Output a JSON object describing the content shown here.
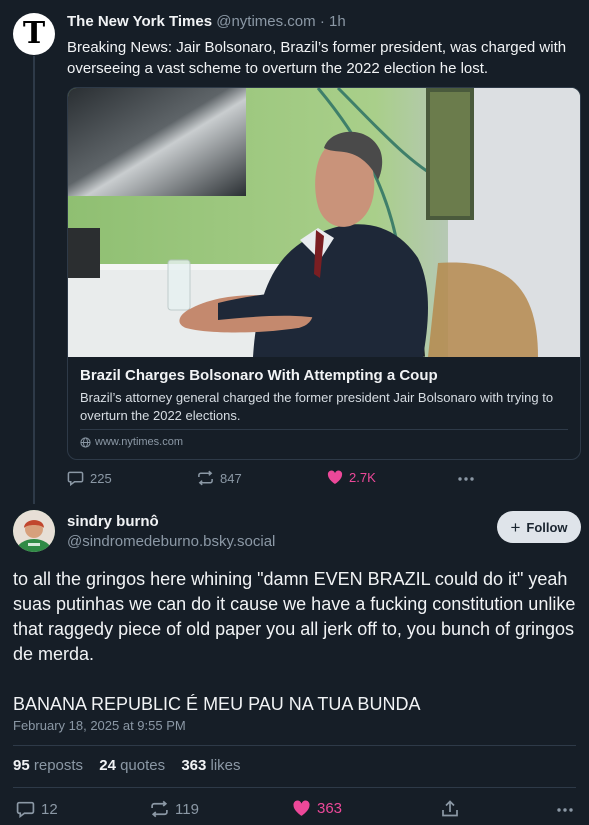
{
  "parent_post": {
    "author_name": "The New York Times",
    "handle": "@nytimes.com",
    "separator": "·",
    "time_ago": "1h",
    "avatar_glyph": "T",
    "text": "Breaking News: Jair Bolsonaro, Brazil’s former president, was charged with overseeing a vast scheme to overturn the 2022 election he lost.",
    "link_card": {
      "title": "Brazil Charges Bolsonaro With Attempting a Coup",
      "description": "Brazil’s attorney general charged the former president Jair Bolsonaro with trying to overturn the 2022 elections.",
      "domain": "www.nytimes.com",
      "domain_icon": "globe-icon"
    },
    "actions": {
      "replies": "225",
      "reposts": "847",
      "likes": "2.7K",
      "more_icon": "ellipsis-icon"
    }
  },
  "main_post": {
    "author_name": "sindry burnô",
    "handle": "@sindromedeburno.bsky.social",
    "follow_label": "Follow",
    "paragraphs": [
      "to all the gringos here whining \"damn EVEN BRAZIL could do it\" yeah suas putinhas we can do it cause we have a fucking constitution unlike that raggedy piece of old paper you all jerk off to, you bunch of gringos de merda.",
      "BANANA REPUBLIC É MEU PAU NA TUA BUNDA"
    ],
    "date": "February 18, 2025 at 9:55 PM",
    "stats": {
      "reposts_count": "95",
      "reposts_label": "reposts",
      "quotes_count": "24",
      "quotes_label": "quotes",
      "likes_count": "363",
      "likes_label": "likes"
    },
    "actions": {
      "replies": "12",
      "reposts": "119",
      "likes": "363",
      "share_icon": "share-icon",
      "more_icon": "ellipsis-icon"
    }
  },
  "colors": {
    "background": "#161e27",
    "text": "#f1f3f5",
    "muted": "#8b98a5",
    "like_pink": "#ec4899",
    "border": "#2e3a48"
  }
}
